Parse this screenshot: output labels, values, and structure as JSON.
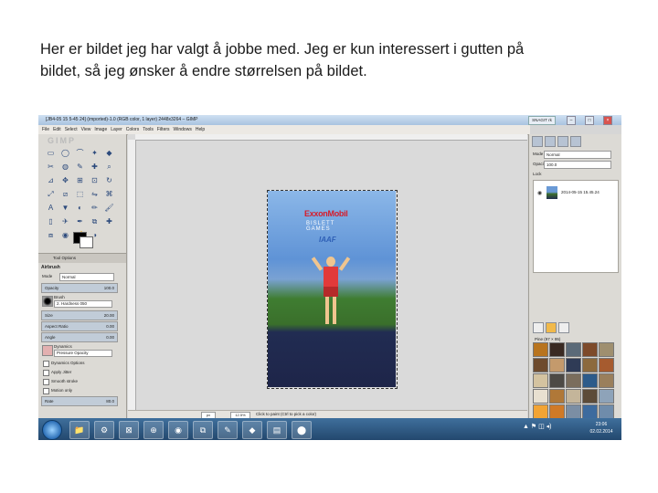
{
  "caption": {
    "line1": "Her er bildet jeg har valgt å jobbe med. Jeg er kun interessert i gutten på",
    "line2": "bildet, så jeg ønsker å endre størrelsen på bildet."
  },
  "window": {
    "title": "[JB4-05 15 5-45 24] (imported)-1.0 (RGB color, 1 layer) 2448x3264 – GIMP",
    "snagit_label": "SNAGIT rk",
    "minimize": "–",
    "maximize": "□",
    "close": "×"
  },
  "menubar": [
    "File",
    "Edit",
    "Select",
    "View",
    "Image",
    "Layer",
    "Colors",
    "Tools",
    "Filters",
    "Windows",
    "Help"
  ],
  "toolbox": {
    "logo_text": "GIMP",
    "tool_icons": [
      "rect-select",
      "ellipse-select",
      "free-select",
      "fuzzy-select",
      "color-select",
      "scissors",
      "foreground-select",
      "paths",
      "color-picker",
      "zoom",
      "measure",
      "move",
      "align",
      "crop",
      "rotate",
      "scale",
      "shear",
      "perspective",
      "flip",
      "cage",
      "text",
      "bucket-fill",
      "blend",
      "pencil",
      "paintbrush",
      "eraser",
      "airbrush",
      "ink",
      "clone",
      "heal",
      "perspective-clone",
      "blur",
      "smudge",
      "dodge"
    ],
    "tool_glyphs": [
      "▭",
      "◯",
      "⌒",
      "✦",
      "◆",
      "✂",
      "◍",
      "✎",
      "✚",
      "⌕",
      "⊿",
      "✥",
      "⊞",
      "⊡",
      "↻",
      "⤢",
      "⧄",
      "⬚",
      "⇋",
      "⌘",
      "A",
      "▼",
      "◐",
      "✏",
      "🖌",
      "▯",
      "✈",
      "✒",
      "⧉",
      "✚",
      "⧈",
      "◉",
      "☝",
      "◑"
    ]
  },
  "tool_options": {
    "tab": "Tool Options",
    "title": "Airbrush",
    "mode_label": "Mode",
    "mode_value": "Normal",
    "opacity_label": "Opacity",
    "opacity_value": "100.0",
    "brush_label": "Brush",
    "brush_value": "2. Hardness 050",
    "size_label": "Size",
    "size_value": "20.00",
    "aspect_label": "Aspect Ratio",
    "aspect_value": "0.00",
    "angle_label": "Angle",
    "angle_value": "0.00",
    "dynamics_label": "Dynamics",
    "dynamics_value": "Pressure Opacity",
    "checkboxes": [
      "Dynamics Options",
      "Apply Jitter",
      "Smooth stroke",
      "Motion only"
    ],
    "rate_label": "Rate",
    "rate_value": "80.0"
  },
  "photo": {
    "logo": "ExxonMobil",
    "logo2": "BISLETT GAMES",
    "sub": "IAAF"
  },
  "statusbar": {
    "unit": "px",
    "zoom": "12.5%",
    "message": "Click to paint (Ctrl to pick a color)"
  },
  "dock": {
    "mode_label": "Mode",
    "mode_value": "Normal",
    "opacity_label": "Opacity",
    "opacity_value": "100.0",
    "lock_label": "Lock",
    "layer_name": "2014-05-15 15.45.24",
    "pattern_title": "Pine (97 × 95)",
    "patterns": [
      "#b8741e",
      "#3a2a22",
      "#5b6a78",
      "#7d4a2a",
      "#9f8f6f",
      "#6e4b2d",
      "#c49a6c",
      "#2f3b56",
      "#8c6a3d",
      "#a65b2f",
      "#d4c3a0",
      "#4d4a45",
      "#7a6d5c",
      "#2c5b8a",
      "#9a7f5c",
      "#e8e0d0",
      "#b07838",
      "#c4b59a",
      "#5c4b38",
      "#8ea3b9",
      "#f2a434",
      "#d07a27",
      "#7b8ea4",
      "#3d6b9e",
      "#6f8cab"
    ]
  },
  "taskbar": {
    "apps": [
      "📁",
      "⚙",
      "⊠",
      "⊕",
      "◉",
      "⧉",
      "✎",
      "◆",
      "▤",
      "⬤"
    ],
    "tray": "▲ ⚑ ◫ ◂)",
    "time": "23:06",
    "date": "02.02.2014"
  },
  "colors": {
    "foreground": "#000000",
    "background": "#ffffff",
    "taskbar": "#2c5680"
  }
}
